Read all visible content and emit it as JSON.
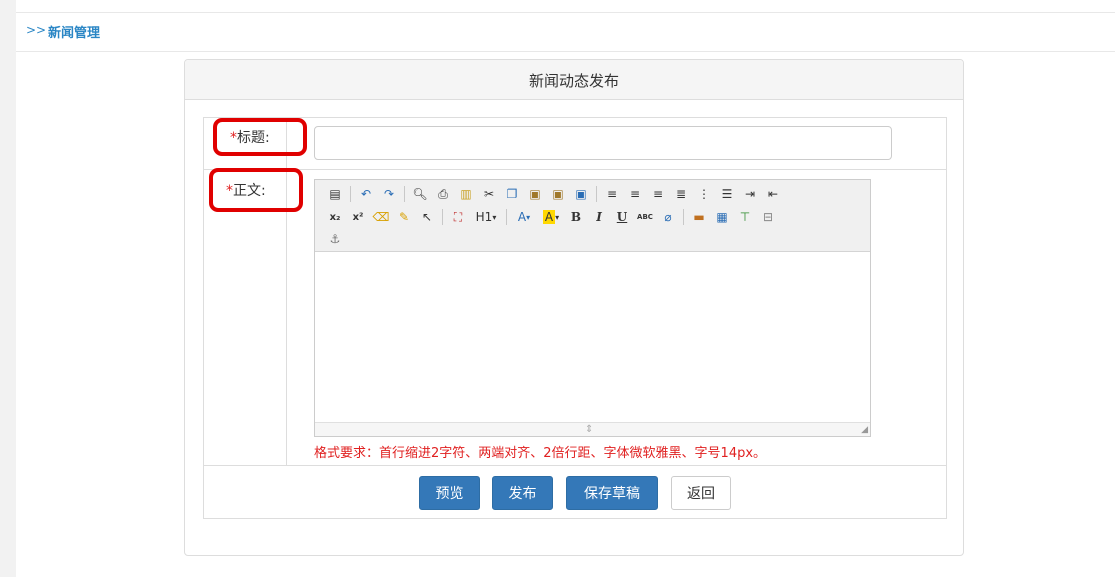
{
  "breadcrumb": {
    "arrow": ">>",
    "label": "新闻管理"
  },
  "panel": {
    "title": "新闻动态发布"
  },
  "form": {
    "title_label_star": "*",
    "title_label": "标题:",
    "title_value": "",
    "body_label_star": "*",
    "body_label": "正文:",
    "format_hint": "格式要求：首行缩进2字符、两端对齐、2倍行距、字体微软雅黑、字号14px。"
  },
  "toolbar": {
    "row1": [
      "source-icon",
      "sep",
      "undo-icon",
      "redo-icon",
      "sep",
      "preview-icon",
      "print-icon",
      "template-icon",
      "cut-icon",
      "copy-icon",
      "paste-icon",
      "paste-text-icon",
      "paste-word-icon",
      "sep",
      "align-left-icon",
      "align-center-icon",
      "align-right-icon",
      "align-justify-icon",
      "ordered-list-icon",
      "unordered-list-icon",
      "indent-icon",
      "outdent-icon"
    ],
    "row2": [
      "subscript-icon",
      "superscript-icon",
      "clear-format-icon",
      "format-painter-icon",
      "select-all-icon",
      "sep",
      "fullscreen-icon",
      "heading-dropdown",
      "sep",
      "font-color-icon",
      "highlight-icon",
      "bold-icon",
      "italic-icon",
      "underline-icon",
      "strikethrough-icon",
      "remove-format-icon",
      "sep",
      "image-icon",
      "table-icon",
      "insert-hr-icon",
      "page-break-icon"
    ],
    "row3": [
      "anchor-icon"
    ],
    "heading_label": "H1",
    "font_color_label": "A",
    "highlight_label": "A",
    "bold_label": "B",
    "italic_label": "I",
    "underline_label": "U",
    "strike_label": "ABC",
    "subscript_label": "x₂",
    "superscript_label": "x²"
  },
  "buttons": {
    "preview": "预览",
    "publish": "发布",
    "save_draft": "保存草稿",
    "back": "返回"
  },
  "colors": {
    "primary": "#3478b8",
    "link": "#2a86c5",
    "required": "#e02020",
    "highlight_ring": "#e00000"
  }
}
